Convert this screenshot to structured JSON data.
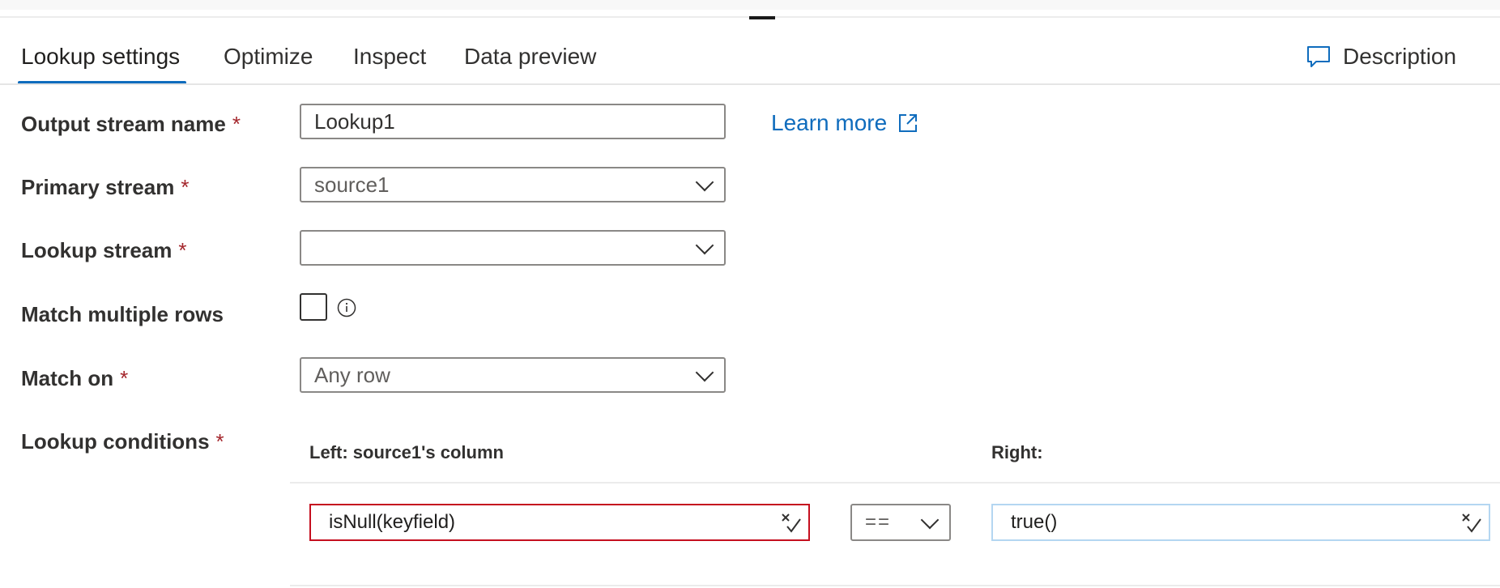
{
  "tabs": [
    {
      "label": "Lookup settings"
    },
    {
      "label": "Optimize"
    },
    {
      "label": "Inspect"
    },
    {
      "label": "Data preview"
    }
  ],
  "description_label": "Description",
  "form": {
    "output_stream_name": {
      "label": "Output stream name",
      "required": "*",
      "value": "Lookup1"
    },
    "learn_more": "Learn more",
    "primary_stream": {
      "label": "Primary stream",
      "required": "*",
      "value": "source1"
    },
    "lookup_stream": {
      "label": "Lookup stream",
      "required": "*",
      "value": ""
    },
    "match_multiple_rows": {
      "label": "Match multiple rows",
      "checked": false
    },
    "match_on": {
      "label": "Match on",
      "required": "*",
      "value": "Any row"
    },
    "lookup_conditions": {
      "label": "Lookup conditions",
      "required": "*",
      "left_header": "Left: source1's column",
      "right_header": "Right:",
      "rows": [
        {
          "left": "isNull(keyfield)",
          "operator": "==",
          "right": "true()"
        }
      ]
    }
  },
  "colors": {
    "accent": "#0f6cbd",
    "required": "#a4262c",
    "error_border": "#c50f1f"
  }
}
